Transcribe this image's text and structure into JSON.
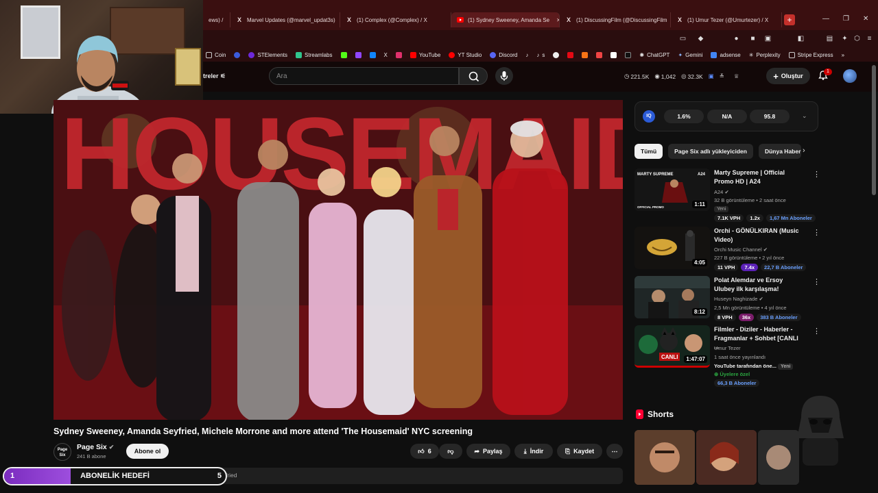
{
  "browser": {
    "tabs": [
      {
        "label": "ews) /",
        "icon": "x-icon",
        "active": false
      },
      {
        "label": "Marvel Updates (@marvel_updat3s)",
        "icon": "x-icon",
        "active": false
      },
      {
        "label": "(1) Complex (@Complex) / X",
        "icon": "x-icon",
        "active": false
      },
      {
        "label": "(1) Sydney Sweeney, Amanda Se",
        "icon": "youtube-icon",
        "active": true
      },
      {
        "label": "(1) DiscussingFilm (@DiscussingFilm",
        "icon": "x-icon",
        "active": false
      },
      {
        "label": "(1) Umur Tezer (@Umurtezer) / X",
        "icon": "x-icon",
        "active": false
      }
    ],
    "new_tab": "+",
    "bookmarks": [
      "Coin",
      "STElements",
      "Streamlabs",
      "YouTube",
      "YT Studio",
      "Discord",
      "s",
      "ChatGPT",
      "Gemini",
      "adsense",
      "Perplexity",
      "Stripe Express"
    ],
    "bookmarks_more": "»"
  },
  "youtube": {
    "filters_left": "treler",
    "search_placeholder": "Ara",
    "stats": [
      "221.5K",
      "1,042",
      "32.3K"
    ],
    "create_label": "Oluştur",
    "notification_count": "1"
  },
  "video": {
    "title": "Sydney Sweeney, Amanda Seyfried, Michele Morrone and more attend 'The Housemaid' NYC screening",
    "channel": "Page Six",
    "channel_avatar_text": "Page Six",
    "subscribers": "241 B abone",
    "subscribe_label": "Abone ol",
    "likes": "6",
    "share_label": "Paylaş",
    "download_label": "İndir",
    "save_label": "Kaydet",
    "description": "383 görüntüleme   #thehousemaid #sydneysweeney #amandaseyfried",
    "sign_text": "HOUSEMAID"
  },
  "goal_bar": {
    "start": "1",
    "label": "ABONELİK HEDEFİ",
    "end": "5",
    "progress": 0.3
  },
  "extension": {
    "logo": "IQ",
    "values": [
      "1.6%",
      "N/A",
      "95.8"
    ]
  },
  "chips": [
    "Tümü",
    "Page Six adlı yükleyiciden",
    "Dünya Haberleri"
  ],
  "recommendations": [
    {
      "title": "Marty Supreme | Official Promo HD | A24",
      "channel": "A24",
      "meta": "32 B görüntüleme • 2 saat önce",
      "duration": "1:11",
      "new": "Yeni",
      "vph": "7.1K VPH",
      "mult": "1.2x",
      "subs": "1,67 Mn Aboneler",
      "thumb_text": "MARTY SUPREME",
      "thumb_badge": "A24",
      "thumb_caption": "OFFICIAL PROMO"
    },
    {
      "title": "Orchi - GÖNÜLKIRAN (Music Video)",
      "channel": "Orchi Music Channel",
      "meta": "227 B görüntüleme • 2 yıl önce",
      "duration": "4:05",
      "vph": "11 VPH",
      "mult": "7.4x",
      "subs": "22,7 B Aboneler"
    },
    {
      "title": "Polat Alemdar ve Ersoy Ulubey ilk karşılaşma!",
      "channel": "Huseyn Naghizade",
      "meta": "2,5 Mn görüntüleme • 4 yıl önce",
      "duration": "8:12",
      "vph": "8 VPH",
      "mult": "36x",
      "subs": "383 B Aboneler"
    },
    {
      "title": "Filmler - Diziler - Haberler - Fragmanlar + Sohbet [CANLI ...",
      "channel": "Umur Tezer",
      "meta": "1 saat önce yayınlandı",
      "duration": "1:47:07",
      "extra": "YouTube tarafından öne...",
      "new": "Yeni",
      "members": "Üyelere özel",
      "subs": "66,3 B Aboneler",
      "thumb_text": "CANLI"
    }
  ],
  "shorts_label": "Shorts",
  "colors": {
    "accent": "#cc0000",
    "goal": "#7b2cbf",
    "subs_blue": "#6aa0ff"
  }
}
